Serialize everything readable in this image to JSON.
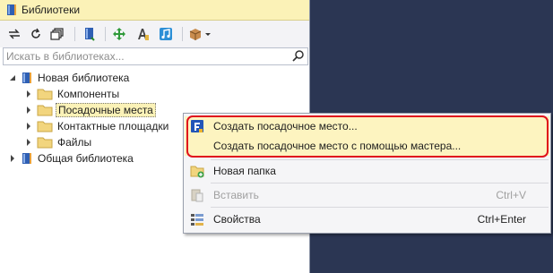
{
  "panel": {
    "title": "Библиотеки",
    "search_placeholder": "Искать в библиотеках..."
  },
  "toolbar": {
    "icons": [
      "sync-arrows-icon",
      "refresh-icon",
      "copy-windows-icon",
      "book-icon",
      "move-icon",
      "font-a-icon",
      "music-note-icon",
      "package-dropdown-icon"
    ]
  },
  "tree": {
    "root1": {
      "label": "Новая библиотека"
    },
    "children": [
      {
        "label": "Компоненты"
      },
      {
        "label": "Посадочные места"
      },
      {
        "label": "Контактные площадки"
      },
      {
        "label": "Файлы"
      }
    ],
    "root2": {
      "label": "Общая библиотека"
    }
  },
  "menu": {
    "items": [
      {
        "label": "Создать посадочное место...",
        "shortcut": ""
      },
      {
        "label": "Создать посадочное место с помощью мастера...",
        "shortcut": ""
      },
      {
        "label": "Новая папка",
        "shortcut": ""
      },
      {
        "label": "Вставить",
        "shortcut": "Ctrl+V"
      },
      {
        "label": "Свойства",
        "shortcut": "Ctrl+Enter"
      }
    ]
  },
  "colors": {
    "title_bg": "#fbf2b7",
    "background": "#2b3653",
    "highlight": "#fdf4c0",
    "annotation_red": "#e0101c"
  }
}
